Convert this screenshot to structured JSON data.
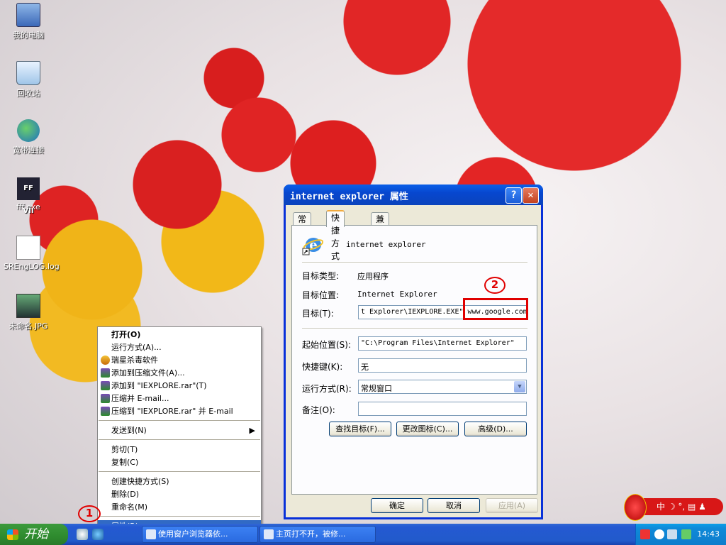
{
  "desktop": {
    "icons": [
      {
        "label": "我的电脑"
      },
      {
        "label": "回收站"
      },
      {
        "label": "宽带连接"
      },
      {
        "label": "fff.exe",
        "glyph": "FF VII"
      },
      {
        "label": "SREngLOG.log"
      },
      {
        "label": "未命名.JPG"
      }
    ]
  },
  "dialog": {
    "title": "internet explorer 属性",
    "help_glyph": "?",
    "close_glyph": "✕",
    "tabs": [
      "常规",
      "快捷方式",
      "兼容性"
    ],
    "shortcut_name": "internet explorer",
    "target_type_label": "目标类型:",
    "target_type_value": "应用程序",
    "target_location_label": "目标位置:",
    "target_location_value": "Internet Explorer",
    "target_label": "目标(T):",
    "target_value": "t Explorer\\IEXPLORE.EXE\" www.google.com",
    "start_in_label": "起始位置(S):",
    "start_in_value": "\"C:\\Program Files\\Internet Explorer\"",
    "hotkey_label": "快捷键(K):",
    "hotkey_value": "无",
    "run_label": "运行方式(R):",
    "run_value": "常规窗口",
    "comment_label": "备注(O):",
    "comment_value": "",
    "find_target_btn": "查找目标(F)...",
    "change_icon_btn": "更改图标(C)...",
    "advanced_btn": "高级(D)...",
    "ok_btn": "确定",
    "cancel_btn": "取消",
    "apply_btn": "应用(A)"
  },
  "context_menu": {
    "items": [
      {
        "label": "打开(O)"
      },
      {
        "label": "运行方式(A)..."
      },
      {
        "label": "瑞星杀毒软件"
      },
      {
        "label": "添加到压缩文件(A)..."
      },
      {
        "label": "添加到 \"IEXPLORE.rar\"(T)"
      },
      {
        "label": "压缩并 E-mail..."
      },
      {
        "label": "压缩到 \"IEXPLORE.rar\" 并 E-mail"
      },
      {
        "label": "发送到(N)",
        "submenu_glyph": "▶"
      },
      {
        "label": "剪切(T)"
      },
      {
        "label": "复制(C)"
      },
      {
        "label": "创建快捷方式(S)"
      },
      {
        "label": "删除(D)"
      },
      {
        "label": "重命名(M)"
      },
      {
        "label": "属性(R)"
      }
    ]
  },
  "annotations": {
    "mark1": "1",
    "mark2": "2"
  },
  "taskbar": {
    "start_label": "开始",
    "tasks": [
      {
        "label": "使用窗户浏览器依..."
      },
      {
        "label": "主页打不开，被修..."
      }
    ],
    "ime_text": "中 ☽ °, ▤ ♟",
    "clock": "14:43"
  }
}
